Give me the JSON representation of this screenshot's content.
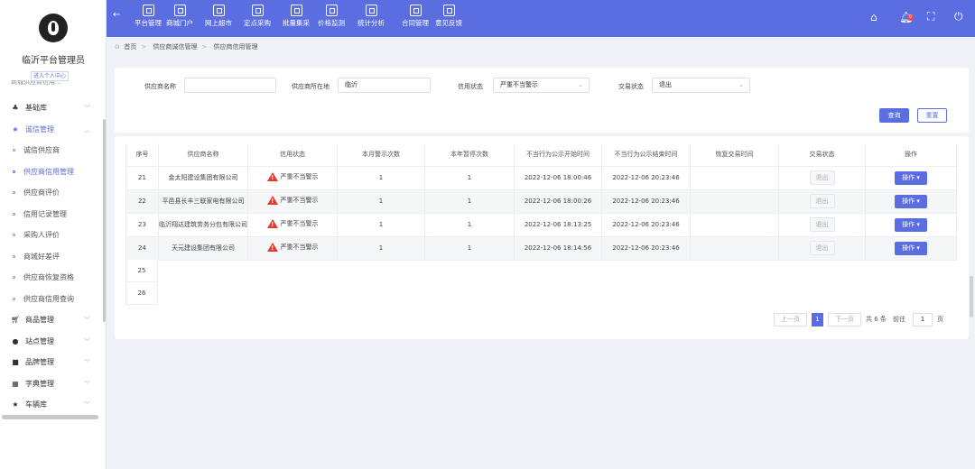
{
  "sidebar": {
    "admin_name": "临沂平台管理员",
    "enter_center": "进入个人中心",
    "clipped_item": "商城供应商信用...",
    "menu": [
      {
        "label": "基础库",
        "icon": "sitemap-icon",
        "type": "parent"
      },
      {
        "label": "诚信管理",
        "icon": "star-icon",
        "type": "parent-open"
      },
      {
        "label": "诚信供应商",
        "type": "sub"
      },
      {
        "label": "供应商信用管理",
        "type": "sub-current"
      },
      {
        "label": "供应商评价",
        "type": "sub"
      },
      {
        "label": "信用记录管理",
        "type": "sub"
      },
      {
        "label": "采购人评价",
        "type": "sub"
      },
      {
        "label": "商城好差评",
        "type": "sub"
      },
      {
        "label": "供应商恢复资格",
        "type": "sub"
      },
      {
        "label": "供应商信用查询",
        "type": "sub"
      },
      {
        "label": "商品管理",
        "icon": "cart-icon",
        "type": "parent"
      },
      {
        "label": "站点管理",
        "icon": "location-icon",
        "type": "parent"
      },
      {
        "label": "品牌管理",
        "icon": "brand-icon",
        "type": "parent"
      },
      {
        "label": "字典管理",
        "icon": "dictionary-icon",
        "type": "parent"
      },
      {
        "label": "车辆库",
        "icon": "star-icon",
        "type": "parent"
      }
    ]
  },
  "topnav": {
    "items": [
      "平台管理",
      "商城门户",
      "网上超市",
      "定点采购",
      "批量集采",
      "价格监测",
      "统计分析",
      "合同管理",
      "意见反馈"
    ],
    "bell_badge": "0"
  },
  "breadcrumb": [
    "首页",
    "供应商诚信管理",
    "供应商信用管理"
  ],
  "filters": {
    "name_label": "供应商名称",
    "name_value": "",
    "location_label": "供应商所在地",
    "location_value": "临沂",
    "credit_label": "信用状态",
    "credit_value": "严重不当警示",
    "trade_label": "交易状态",
    "trade_value": "退出",
    "search_btn": "查询",
    "reset_btn": "重置"
  },
  "table": {
    "headers": [
      "序号",
      "供应商名称",
      "信用状态",
      "本月警示次数",
      "本年暂停次数",
      "不当行为公示开始时间",
      "不当行为公示结束时间",
      "恢复交易时间",
      "交易状态",
      "操作"
    ],
    "rows": [
      {
        "no": "21",
        "name": "金太阳建设集团有限公司",
        "credit": "严重不当警示",
        "warn": "1",
        "pause": "1",
        "start": "2022-12-06 18:00:46",
        "end": "2022-12-06 20:23:46",
        "restore": "",
        "trade": "退出",
        "op": "操作 ▾"
      },
      {
        "no": "22",
        "name": "平邑县长丰三联家电有限公司",
        "credit": "严重不当警示",
        "warn": "1",
        "pause": "1",
        "start": "2022-12-06 18:00:26",
        "end": "2022-12-06 20:23:46",
        "restore": "",
        "trade": "退出",
        "op": "操作 ▾"
      },
      {
        "no": "23",
        "name": "临沂翔达建筑劳务分包有限公司",
        "credit": "严重不当警示",
        "warn": "1",
        "pause": "1",
        "start": "2022-12-06 18:13:25",
        "end": "2022-12-06 20:23:46",
        "restore": "",
        "trade": "退出",
        "op": "操作 ▾"
      },
      {
        "no": "24",
        "name": "天元建设集团有限公司",
        "credit": "严重不当警示",
        "warn": "1",
        "pause": "1",
        "start": "2022-12-06 18:14:56",
        "end": "2022-12-06 20:23:46",
        "restore": "",
        "trade": "退出",
        "op": "操作 ▾"
      }
    ],
    "extra_numbers": [
      "25",
      "26"
    ]
  },
  "pager": {
    "prev": "上一页",
    "current": "1",
    "next": "下一页",
    "total": "共 6 条",
    "goto": "前往",
    "goto_value": "1",
    "page_unit": "页"
  },
  "colors": {
    "accent": "#5b6ee1",
    "warning": "#e23b2e"
  }
}
